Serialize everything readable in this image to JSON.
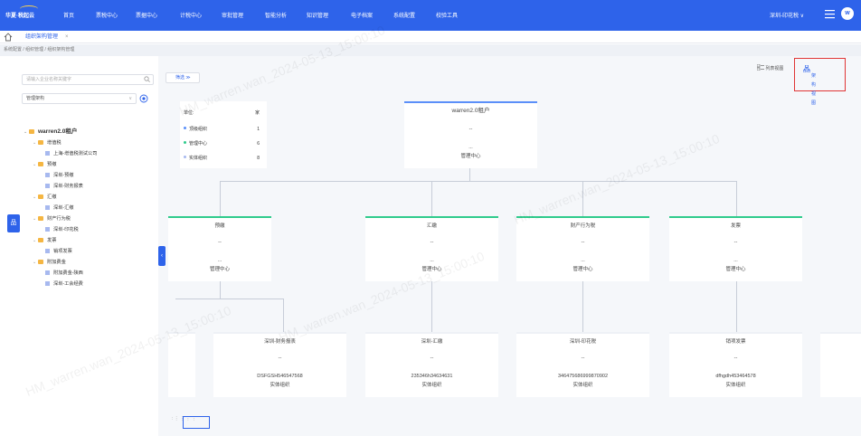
{
  "header": {
    "logo_text": "华夏·税起云",
    "nav": [
      "首页",
      "票税中心",
      "票据中心",
      "计税中心",
      "审批管理",
      "智能分析",
      "知识管理",
      "电子档案",
      "系统配置",
      "校验工具"
    ],
    "org_select": "深圳-印花税",
    "org_caret": "∨",
    "avatar_letter": "w"
  },
  "tabs": [
    {
      "label": "组织架构管理",
      "close": "×"
    }
  ],
  "breadcrumb": "系统配置 / 组织管理 / 组织架构管理",
  "sidebar": {
    "search_placeholder": "请输入企业名称关键字",
    "select_value": "管理架构",
    "select_caret": "∨",
    "tree": [
      {
        "label": "warren2.0租户",
        "level": 0,
        "type": "folder",
        "caret": "⌄"
      },
      {
        "label": "增值税",
        "level": 1,
        "type": "folder",
        "caret": "⌄"
      },
      {
        "label": "上海-增值税测试公司",
        "level": 2,
        "type": "leaf"
      },
      {
        "label": "预缴",
        "level": 1,
        "type": "folder",
        "caret": "⌄"
      },
      {
        "label": "深圳-预缴",
        "level": 2,
        "type": "leaf"
      },
      {
        "label": "深圳-财务报表",
        "level": 2,
        "type": "leaf"
      },
      {
        "label": "汇缴",
        "level": 1,
        "type": "folder",
        "caret": "⌄"
      },
      {
        "label": "深圳-汇缴",
        "level": 2,
        "type": "leaf"
      },
      {
        "label": "财产行为税",
        "level": 1,
        "type": "folder",
        "caret": "⌄"
      },
      {
        "label": "深圳-印花税",
        "level": 2,
        "type": "leaf"
      },
      {
        "label": "发票",
        "level": 1,
        "type": "folder",
        "caret": "⌄"
      },
      {
        "label": "销项发票",
        "level": 2,
        "type": "leaf"
      },
      {
        "label": "附加费金",
        "level": 1,
        "type": "folder",
        "caret": "⌄"
      },
      {
        "label": "附加费金-陕西",
        "level": 2,
        "type": "leaf"
      },
      {
        "label": "深圳-工会经费",
        "level": 2,
        "type": "leaf"
      }
    ],
    "side_tab_label": "品",
    "collapse_label": "‹"
  },
  "toolbar": {
    "filter_label": "筛选 ≫",
    "list_view_label": "列表视图",
    "arch_view_label": "架构视图"
  },
  "legend": {
    "header_unit": "单位:",
    "header_unit_value": "家",
    "rows": [
      {
        "label": "顶级组织",
        "value": "1",
        "color": "#5b8ff9"
      },
      {
        "label": "管理中心",
        "value": "6",
        "color": "#2fcb8c"
      },
      {
        "label": "实体组织",
        "value": "8",
        "color": "#a7b9ef"
      }
    ]
  },
  "org_chart": {
    "root": {
      "title": "warren2.0租户",
      "line1": "--",
      "line2": "...",
      "type": "管理中心"
    },
    "level1": [
      {
        "title": "预缴",
        "line1": "--",
        "line2": "...",
        "type": "管理中心"
      },
      {
        "title": "汇缴",
        "line1": "--",
        "line2": "...",
        "type": "管理中心"
      },
      {
        "title": "财产行为税",
        "line1": "--",
        "line2": "...",
        "type": "管理中心"
      },
      {
        "title": "发票",
        "line1": "--",
        "line2": "...",
        "type": "管理中心"
      }
    ],
    "level2": [
      {
        "title": "深圳-财务报表",
        "line1": "--",
        "code": "DSFGSH546547568",
        "type": "实体组织"
      },
      {
        "title": "深圳-汇缴",
        "line1": "--",
        "code": "235346h34634631",
        "type": "实体组织"
      },
      {
        "title": "深圳-印花税",
        "line1": "--",
        "code": "346475686999870902",
        "type": "实体组织"
      },
      {
        "title": "销项发票",
        "line1": "--",
        "code": "dfhgdh453464578",
        "type": "实体组织"
      }
    ]
  },
  "minimap_label": ":  ⋮  ⋮  ⋮  ⋮",
  "watermark": "HM_warren.wan_2024-05-13_15:00:10",
  "colors": {
    "primary": "#2e63ea",
    "highlight_border": "#e03535",
    "mgmt_top": "#2fcb8c",
    "root_top": "#5b8ff9"
  }
}
